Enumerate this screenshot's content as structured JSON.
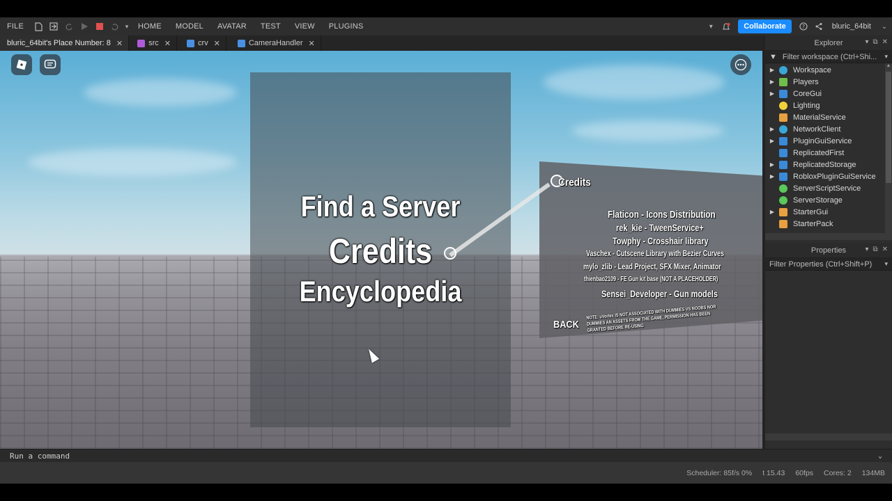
{
  "menubar": {
    "file": "FILE",
    "tabs": [
      "HOME",
      "MODEL",
      "AVATAR",
      "TEST",
      "VIEW",
      "PLUGINS"
    ],
    "collaborate": "Collaborate",
    "username": "bluric_64bit"
  },
  "tabs": [
    {
      "label": "bluric_64bit's Place Number: 8",
      "active": true
    },
    {
      "label": "src",
      "icon_color": "#b05ad8"
    },
    {
      "label": "crv",
      "icon_color": "#4a90e2"
    },
    {
      "label": "CameraHandler",
      "icon_color": "#4a90e2"
    }
  ],
  "viewport": {
    "menu": {
      "find_server": "Find a Server",
      "credits": "Credits",
      "encyclopedia": "Encyclopedia"
    },
    "credits_board": {
      "title": "Credits",
      "lines": [
        "Flaticon - Icons Distribution",
        "rek_kie - TweenService+",
        "Towphy - Crosshair library",
        "Vaschex - Cutscene Library with Bezier Curves",
        "mylo_zlib - Lead Project, SFX Mixer, Animator",
        "thienbao2109 - FE Gun kit base (NOT A PLACEHOLDER)",
        "Sensei_Developer - Gun models"
      ],
      "back": "BACK",
      "note": "NOTE: uVortex IS NOT ASSOCIATED WITH DUMMIES VS NOOBS NOR DUMMIES AN ASSETS FROM THE GAME, PERMISSION HAS BEEN GRANTED BEFORE RE-USING"
    }
  },
  "explorer": {
    "title": "Explorer",
    "filter": "Filter workspace (Ctrl+Shi...",
    "items": [
      {
        "label": "Workspace",
        "expandable": true,
        "icon_color": "#3aa7d8"
      },
      {
        "label": "Players",
        "expandable": true,
        "icon_color": "#6fbf4a"
      },
      {
        "label": "CoreGui",
        "expandable": true,
        "icon_color": "#3a8ad8"
      },
      {
        "label": "Lighting",
        "expandable": false,
        "icon_color": "#f2d03a"
      },
      {
        "label": "MaterialService",
        "expandable": false,
        "icon_color": "#e8a040"
      },
      {
        "label": "NetworkClient",
        "expandable": true,
        "icon_color": "#3aa7d8"
      },
      {
        "label": "PluginGuiService",
        "expandable": true,
        "icon_color": "#3a8ad8"
      },
      {
        "label": "ReplicatedFirst",
        "expandable": false,
        "icon_color": "#3a8ad8"
      },
      {
        "label": "ReplicatedStorage",
        "expandable": true,
        "icon_color": "#3a8ad8"
      },
      {
        "label": "RobloxPluginGuiService",
        "expandable": true,
        "icon_color": "#3a8ad8"
      },
      {
        "label": "ServerScriptService",
        "expandable": false,
        "icon_color": "#5ac85a"
      },
      {
        "label": "ServerStorage",
        "expandable": false,
        "icon_color": "#5ac85a"
      },
      {
        "label": "StarterGui",
        "expandable": true,
        "icon_color": "#e8a040"
      },
      {
        "label": "StarterPack",
        "expandable": false,
        "icon_color": "#e8a040"
      }
    ]
  },
  "properties": {
    "title": "Properties",
    "filter": "Filter Properties (Ctrl+Shift+P)"
  },
  "command": {
    "placeholder": "Run a command"
  },
  "status": {
    "scheduler": "Scheduler: 85f/s 0%",
    "time": "t 15.43",
    "fps": "60fps",
    "cores": "Cores: 2",
    "memory": "134MB"
  }
}
